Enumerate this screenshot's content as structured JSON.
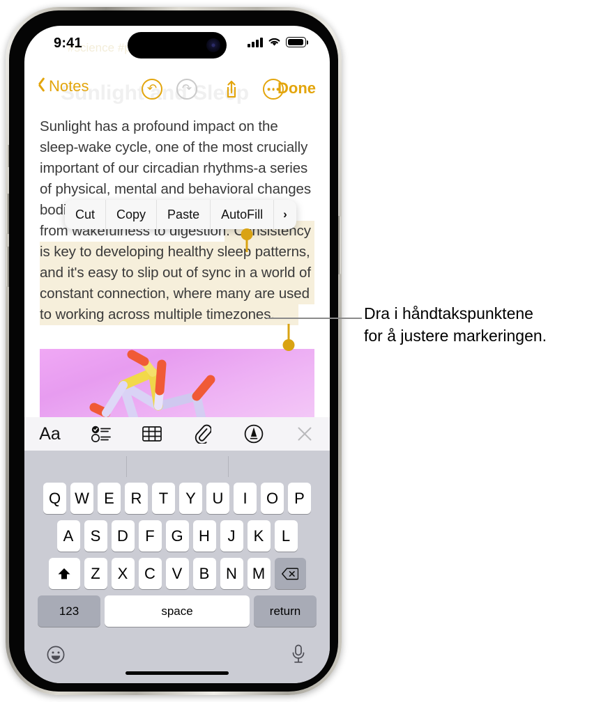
{
  "status_bar": {
    "time": "9:41",
    "signal_icon": "cellular-signal-icon",
    "wifi_icon": "wifi-icon",
    "battery_icon": "battery-icon"
  },
  "ghost_content": {
    "tags": "#science  #psychology",
    "title": "Sunlight and Sleep"
  },
  "nav_bar": {
    "back_label": "Notes",
    "undo_label": "Undo",
    "redo_label": "Redo",
    "share_label": "Share",
    "more_label": "More",
    "done_label": "Done"
  },
  "note": {
    "lines": [
      {
        "text": "Sunlight has a profound impact on the",
        "highlight": "none"
      },
      {
        "text": "sleep-wake cycle, one of the most crucially",
        "highlight": "none"
      },
      {
        "text": "important of our circadian rhythms-a series",
        "highlight": "none"
      },
      {
        "text": "of physical, mental and behavioral changes",
        "highlight": "none"
      },
      {
        "text": "bodies' functions to optimize everything",
        "highlight": "none"
      },
      {
        "text": "from wakefulness to digestion. Consistency",
        "highlight": "partial"
      },
      {
        "text": "is key to developing healthy sleep patterns,",
        "highlight": "full"
      },
      {
        "text": "and it's easy to slip out of sync in a world of",
        "highlight": "full"
      },
      {
        "text": "constant connection, where many are used",
        "highlight": "full"
      },
      {
        "text": "to working across multiple timezones.",
        "highlight": "end"
      }
    ],
    "image_alt": "molecule-illustration"
  },
  "edit_menu": {
    "items": [
      "Cut",
      "Copy",
      "Paste",
      "AutoFill"
    ],
    "more_chevron": "›"
  },
  "format_toolbar": {
    "buttons": [
      {
        "name": "text-format-icon",
        "label": "Aa"
      },
      {
        "name": "checklist-icon",
        "label": "Checklist"
      },
      {
        "name": "table-icon",
        "label": "Table"
      },
      {
        "name": "attachment-icon",
        "label": "Attach"
      },
      {
        "name": "markup-pen-icon",
        "label": "Markup"
      },
      {
        "name": "close-icon",
        "label": "Close"
      }
    ]
  },
  "keyboard": {
    "row1": [
      "Q",
      "W",
      "E",
      "R",
      "T",
      "Y",
      "U",
      "I",
      "O",
      "P"
    ],
    "row2": [
      "A",
      "S",
      "D",
      "F",
      "G",
      "H",
      "J",
      "K",
      "L"
    ],
    "row3": [
      "Z",
      "X",
      "C",
      "V",
      "B",
      "N",
      "M"
    ],
    "shift_label": "shift",
    "delete_label": "delete",
    "numbers_label": "123",
    "space_label": "space",
    "return_label": "return",
    "emoji_label": "emoji",
    "dictation_label": "dictation"
  },
  "callout": {
    "line1": "Dra i håndtakspunktene",
    "line2": "for å justere markeringen."
  },
  "colors": {
    "accent": "#e3a50c",
    "handle": "#d9a313",
    "highlight": "#f6efdb",
    "keyboard_bg": "#cbccd4",
    "toolbar_bg": "#f5f4f7"
  }
}
